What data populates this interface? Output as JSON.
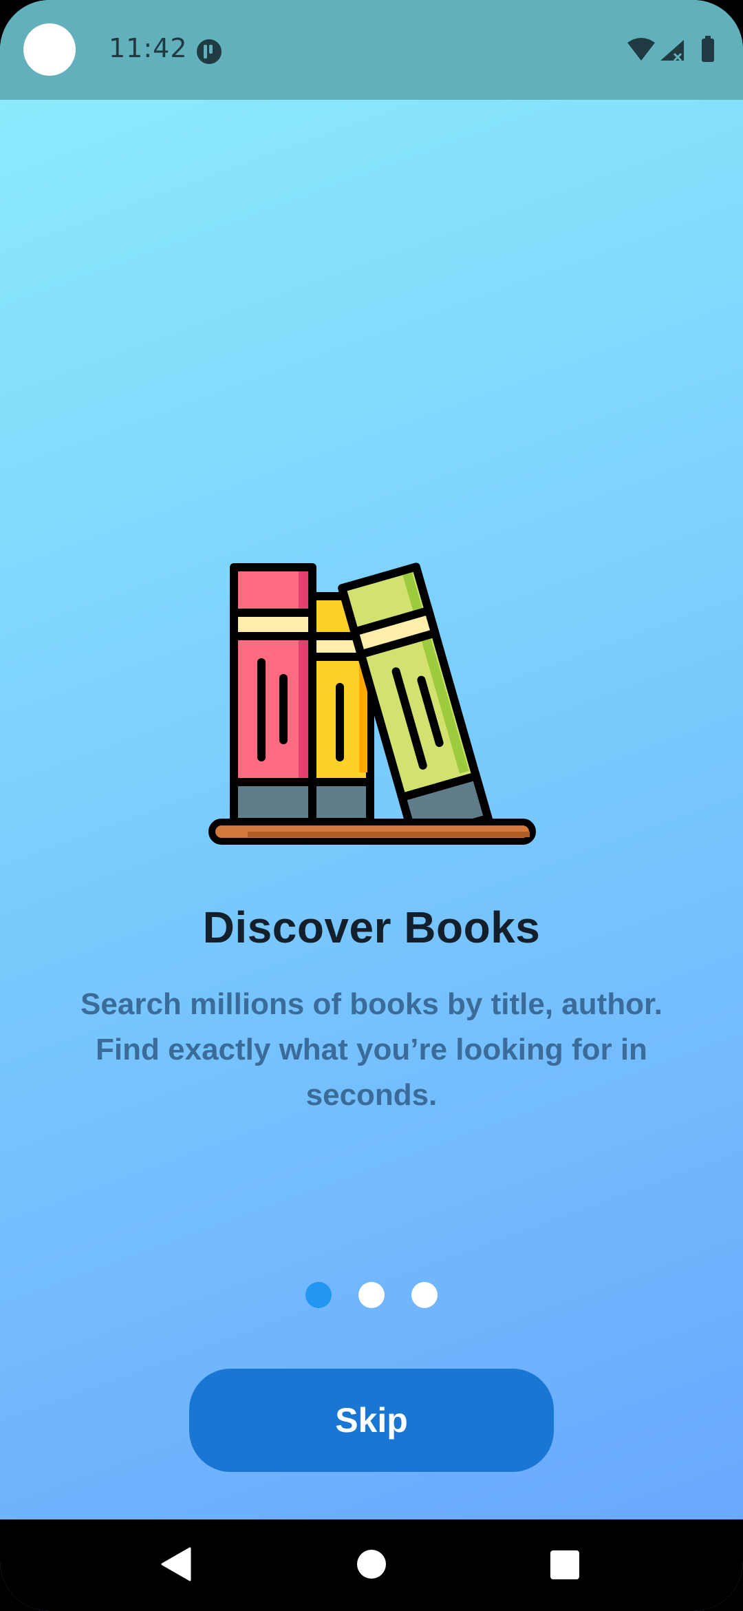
{
  "status_bar": {
    "time": "11:42",
    "app_icon": "app-notification-icon",
    "icons": [
      "wifi-icon",
      "signal-icon",
      "battery-icon"
    ]
  },
  "onboarding": {
    "illustration": "books-icon",
    "title": "Discover Books",
    "description": "Search millions of books by title, author. Find exactly what you’re looking for in seconds.",
    "page_count": 3,
    "current_page": 1
  },
  "actions": {
    "skip_label": "Skip"
  },
  "nav_bar": {
    "icons": [
      "back-icon",
      "home-icon",
      "recents-icon"
    ]
  },
  "colors": {
    "accent": "#1976d2",
    "active_dot": "#2196f3",
    "status_bar": "#63b0bd"
  }
}
